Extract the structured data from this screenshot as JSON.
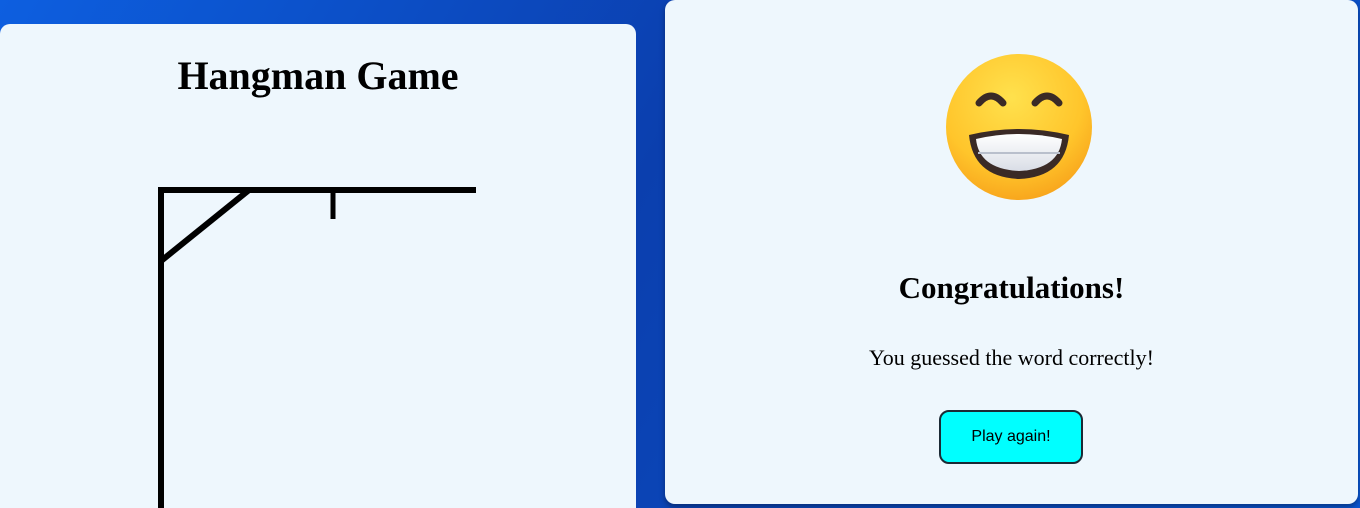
{
  "game": {
    "title": "Hangman Game",
    "wrong_guesses_drawn": 0
  },
  "result": {
    "emoji_icon": "grinning-face-with-smiling-eyes-icon",
    "title": "Congratulations!",
    "message": "You guessed the word correctly!",
    "play_again_label": "Play again!"
  },
  "colors": {
    "panel_background": "#eef7fd",
    "page_background": "#0b3fae",
    "button_background": "#00ffff",
    "gallows_stroke": "#000000"
  }
}
